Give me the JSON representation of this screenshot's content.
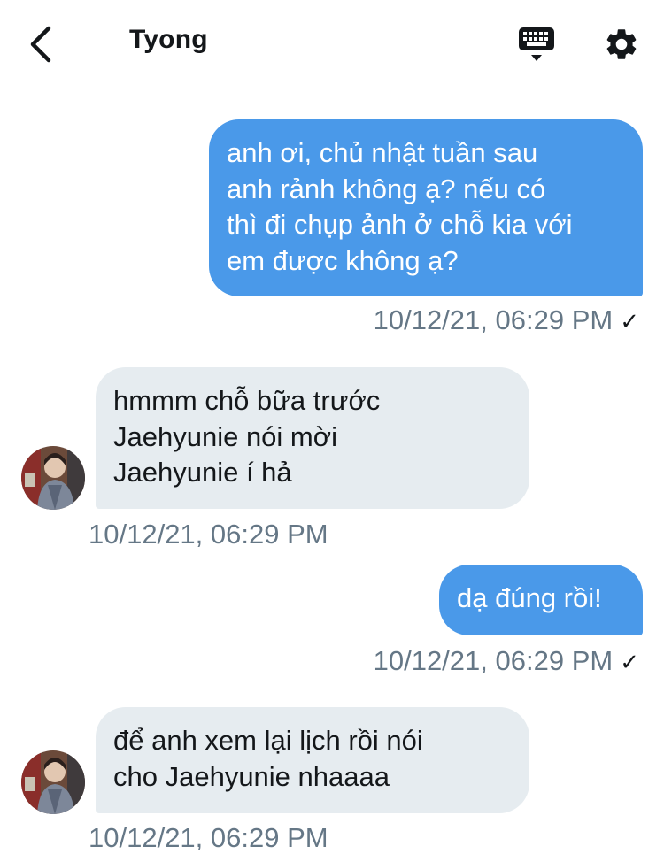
{
  "header": {
    "back_icon": "chevron-left-icon",
    "title": "Tyong",
    "keyboard_icon": "keyboard-icon",
    "settings_icon": "gear-icon"
  },
  "messages": [
    {
      "direction": "sent",
      "text": "anh ơi, chủ nhật tuần sau\nanh rảnh không ạ? nếu có\nthì đi chụp ảnh ở chỗ kia với\nem được không ạ?",
      "timestamp": "10/12/21, 06:29 PM",
      "status": "✓"
    },
    {
      "direction": "received",
      "text": "hmmm chỗ bữa trước\nJaehyunie nói mời\nJaehyunie í hả",
      "timestamp": "10/12/21, 06:29 PM"
    },
    {
      "direction": "sent",
      "text": "dạ đúng rồi!",
      "timestamp": "10/12/21, 06:29 PM",
      "status": "✓"
    },
    {
      "direction": "received",
      "text": "để anh xem lại lịch rồi nói\ncho Jaehyunie nhaaaa",
      "timestamp": "10/12/21, 06:29 PM"
    }
  ],
  "colors": {
    "sent_bubble": "#4a99e9",
    "received_bubble": "#e6ecf0",
    "timestamp": "#657786",
    "text_dark": "#14171a"
  }
}
